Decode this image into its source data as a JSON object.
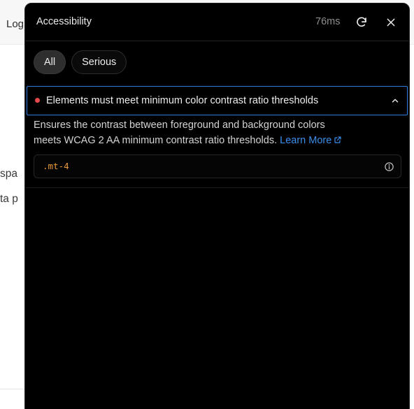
{
  "background": {
    "header_text": "Log",
    "text_lines": [
      "spa",
      "ta p"
    ]
  },
  "panel": {
    "title": "Accessibility",
    "timing": "76ms",
    "refresh_icon": "refresh-icon",
    "close_icon": "close-icon"
  },
  "filters": [
    {
      "label": "All",
      "active": true
    },
    {
      "label": "Serious",
      "active": false
    }
  ],
  "issue": {
    "title": "Elements must meet minimum color contrast ratio thresholds",
    "severity_color": "#e5484d",
    "expanded": true,
    "description_line1": "Ensures the contrast between foreground and background colors",
    "description_line2": "meets WCAG 2 AA minimum contrast ratio thresholds.",
    "learn_more": "Learn More",
    "selector": ".mt-4"
  },
  "colors": {
    "accent": "#2f7fe0",
    "link": "#3b8eea",
    "selector": "#e89a3c",
    "panel_bg": "#000000"
  }
}
